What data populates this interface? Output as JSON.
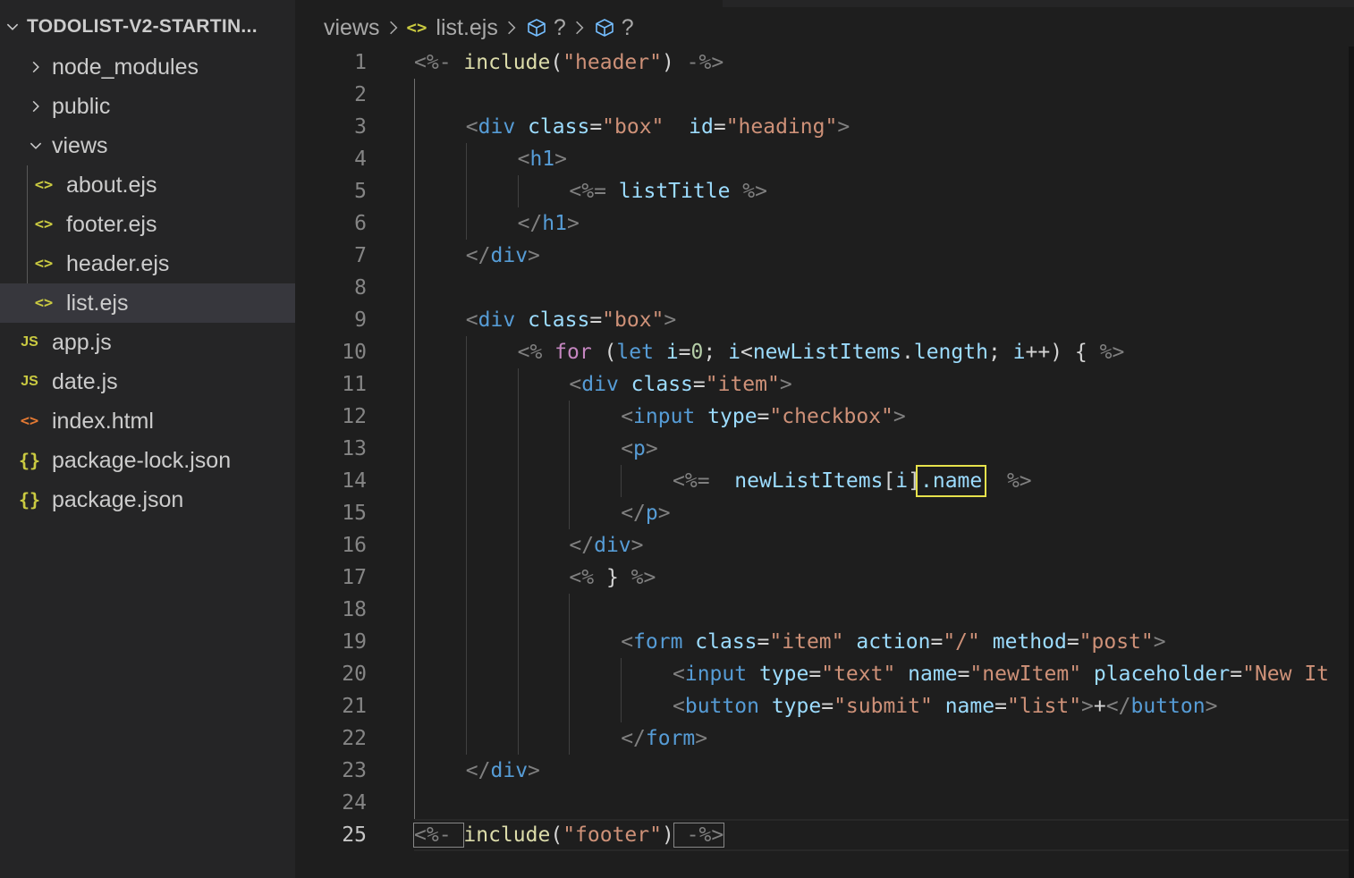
{
  "explorer": {
    "root_label": "TODOLIST-V2-STARTIN...",
    "items": [
      {
        "label": "node_modules",
        "kind": "folder",
        "expanded": false
      },
      {
        "label": "public",
        "kind": "folder",
        "expanded": false
      },
      {
        "label": "views",
        "kind": "folder",
        "expanded": true
      },
      {
        "label": "about.ejs",
        "kind": "ejs",
        "icon": "<>"
      },
      {
        "label": "footer.ejs",
        "kind": "ejs",
        "icon": "<>"
      },
      {
        "label": "header.ejs",
        "kind": "ejs",
        "icon": "<>"
      },
      {
        "label": "list.ejs",
        "kind": "ejs",
        "icon": "<>",
        "selected": true
      },
      {
        "label": "app.js",
        "kind": "js",
        "icon": "JS"
      },
      {
        "label": "date.js",
        "kind": "js",
        "icon": "JS"
      },
      {
        "label": "index.html",
        "kind": "html",
        "icon": "<>"
      },
      {
        "label": "package-lock.json",
        "kind": "json",
        "icon": "{}"
      },
      {
        "label": "package.json",
        "kind": "json",
        "icon": "{}"
      }
    ]
  },
  "breadcrumb": {
    "folder": "views",
    "file_icon": "<>",
    "file": "list.ejs",
    "symbol1": "?",
    "symbol2": "?"
  },
  "editor": {
    "active_line": 25,
    "lines": [
      {
        "n": "1",
        "tokens": [
          [
            "d",
            "<%- "
          ],
          [
            "f",
            "include"
          ],
          [
            "p",
            "("
          ],
          [
            "s",
            "\"header\""
          ],
          [
            "p",
            ")"
          ],
          [
            "d",
            " -%>"
          ]
        ]
      },
      {
        "n": "2",
        "tokens": []
      },
      {
        "n": "3",
        "tokens": [
          [
            "d",
            "<"
          ],
          [
            "t",
            "div"
          ],
          [
            "p",
            " "
          ],
          [
            "a",
            "class"
          ],
          [
            "p",
            "="
          ],
          [
            "s",
            "\"box\""
          ],
          [
            "p",
            "  "
          ],
          [
            "a",
            "id"
          ],
          [
            "p",
            "="
          ],
          [
            "s",
            "\"heading\""
          ],
          [
            "d",
            ">"
          ]
        ]
      },
      {
        "n": "4",
        "tokens": [
          [
            "d",
            "<"
          ],
          [
            "t",
            "h1"
          ],
          [
            "d",
            ">"
          ]
        ]
      },
      {
        "n": "5",
        "tokens": [
          [
            "d",
            "<%="
          ],
          [
            "p",
            " "
          ],
          [
            "v",
            "listTitle"
          ],
          [
            "p",
            " "
          ],
          [
            "d",
            "%>"
          ]
        ]
      },
      {
        "n": "6",
        "tokens": [
          [
            "d",
            "</"
          ],
          [
            "t",
            "h1"
          ],
          [
            "d",
            ">"
          ]
        ]
      },
      {
        "n": "7",
        "tokens": [
          [
            "d",
            "</"
          ],
          [
            "t",
            "div"
          ],
          [
            "d",
            ">"
          ]
        ]
      },
      {
        "n": "8",
        "tokens": []
      },
      {
        "n": "9",
        "tokens": [
          [
            "d",
            "<"
          ],
          [
            "t",
            "div"
          ],
          [
            "p",
            " "
          ],
          [
            "a",
            "class"
          ],
          [
            "p",
            "="
          ],
          [
            "s",
            "\"box\""
          ],
          [
            "d",
            ">"
          ]
        ]
      },
      {
        "n": "10",
        "tokens": [
          [
            "d",
            "<%"
          ],
          [
            "p",
            " "
          ],
          [
            "k",
            "for"
          ],
          [
            "p",
            " ("
          ],
          [
            "t",
            "let"
          ],
          [
            "p",
            " "
          ],
          [
            "v",
            "i"
          ],
          [
            "p",
            "="
          ],
          [
            "n",
            "0"
          ],
          [
            "p",
            "; "
          ],
          [
            "v",
            "i"
          ],
          [
            "p",
            "<"
          ],
          [
            "v",
            "newListItems"
          ],
          [
            "p",
            "."
          ],
          [
            "v",
            "length"
          ],
          [
            "p",
            "; "
          ],
          [
            "v",
            "i"
          ],
          [
            "p",
            "++) { "
          ],
          [
            "d",
            "%>"
          ]
        ]
      },
      {
        "n": "11",
        "tokens": [
          [
            "d",
            "<"
          ],
          [
            "t",
            "div"
          ],
          [
            "p",
            " "
          ],
          [
            "a",
            "class"
          ],
          [
            "p",
            "="
          ],
          [
            "s",
            "\"item\""
          ],
          [
            "d",
            ">"
          ]
        ]
      },
      {
        "n": "12",
        "tokens": [
          [
            "d",
            "<"
          ],
          [
            "t",
            "input"
          ],
          [
            "p",
            " "
          ],
          [
            "a",
            "type"
          ],
          [
            "p",
            "="
          ],
          [
            "s",
            "\"checkbox\""
          ],
          [
            "d",
            ">"
          ]
        ]
      },
      {
        "n": "13",
        "tokens": [
          [
            "d",
            "<"
          ],
          [
            "t",
            "p"
          ],
          [
            "d",
            ">"
          ]
        ]
      },
      {
        "n": "14",
        "tokens": [
          [
            "d",
            "<%="
          ],
          [
            "p",
            "  "
          ],
          [
            "v",
            "newListItems"
          ],
          [
            "p",
            "["
          ],
          [
            "v",
            "i"
          ],
          [
            "p",
            "]"
          ],
          [
            "v",
            ".name"
          ],
          [
            "p",
            "  "
          ],
          [
            "d",
            "%>"
          ]
        ]
      },
      {
        "n": "15",
        "tokens": [
          [
            "d",
            "</"
          ],
          [
            "t",
            "p"
          ],
          [
            "d",
            ">"
          ]
        ]
      },
      {
        "n": "16",
        "tokens": [
          [
            "d",
            "</"
          ],
          [
            "t",
            "div"
          ],
          [
            "d",
            ">"
          ]
        ]
      },
      {
        "n": "17",
        "tokens": [
          [
            "d",
            "<%"
          ],
          [
            "p",
            " } "
          ],
          [
            "d",
            "%>"
          ]
        ]
      },
      {
        "n": "18",
        "tokens": []
      },
      {
        "n": "19",
        "tokens": [
          [
            "d",
            "<"
          ],
          [
            "t",
            "form"
          ],
          [
            "p",
            " "
          ],
          [
            "a",
            "class"
          ],
          [
            "p",
            "="
          ],
          [
            "s",
            "\"item\""
          ],
          [
            "p",
            " "
          ],
          [
            "a",
            "action"
          ],
          [
            "p",
            "="
          ],
          [
            "s",
            "\"/\""
          ],
          [
            "p",
            " "
          ],
          [
            "a",
            "method"
          ],
          [
            "p",
            "="
          ],
          [
            "s",
            "\"post\""
          ],
          [
            "d",
            ">"
          ]
        ]
      },
      {
        "n": "20",
        "tokens": [
          [
            "d",
            "<"
          ],
          [
            "t",
            "input"
          ],
          [
            "p",
            " "
          ],
          [
            "a",
            "type"
          ],
          [
            "p",
            "="
          ],
          [
            "s",
            "\"text\""
          ],
          [
            "p",
            " "
          ],
          [
            "a",
            "name"
          ],
          [
            "p",
            "="
          ],
          [
            "s",
            "\"newItem\""
          ],
          [
            "p",
            " "
          ],
          [
            "a",
            "placeholder"
          ],
          [
            "p",
            "="
          ],
          [
            "s",
            "\"New It"
          ]
        ]
      },
      {
        "n": "21",
        "tokens": [
          [
            "d",
            "<"
          ],
          [
            "t",
            "button"
          ],
          [
            "p",
            " "
          ],
          [
            "a",
            "type"
          ],
          [
            "p",
            "="
          ],
          [
            "s",
            "\"submit\""
          ],
          [
            "p",
            " "
          ],
          [
            "a",
            "name"
          ],
          [
            "p",
            "="
          ],
          [
            "s",
            "\"list\""
          ],
          [
            "d",
            ">"
          ],
          [
            "p",
            "+"
          ],
          [
            "d",
            "</"
          ],
          [
            "t",
            "button"
          ],
          [
            "d",
            ">"
          ]
        ]
      },
      {
        "n": "22",
        "tokens": [
          [
            "d",
            "</"
          ],
          [
            "t",
            "form"
          ],
          [
            "d",
            ">"
          ]
        ]
      },
      {
        "n": "23",
        "tokens": [
          [
            "d",
            "</"
          ],
          [
            "t",
            "div"
          ],
          [
            "d",
            ">"
          ]
        ]
      },
      {
        "n": "24",
        "tokens": []
      },
      {
        "n": "25",
        "tokens": [
          [
            "d",
            "<%- "
          ],
          [
            "f",
            "include"
          ],
          [
            "p",
            "("
          ],
          [
            "s",
            "\"footer\""
          ],
          [
            "p",
            ")"
          ],
          [
            "d",
            " -%>"
          ]
        ]
      }
    ]
  }
}
